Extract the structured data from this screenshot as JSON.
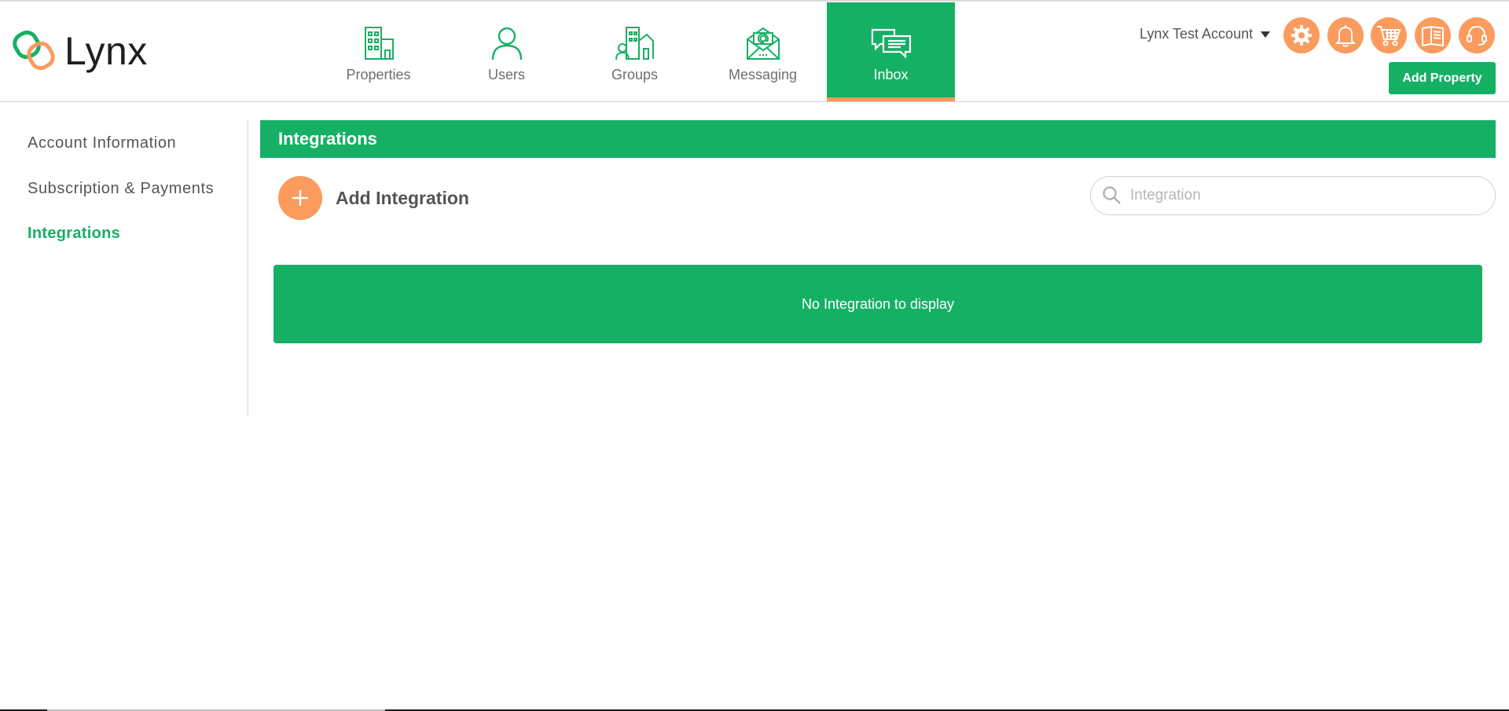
{
  "app": {
    "logo_text": "Lynx",
    "colors": {
      "primary": "#16b065",
      "accent": "#fb9b5d",
      "text": "#555555"
    }
  },
  "nav": {
    "items": [
      {
        "label": "Properties",
        "icon": "building-icon",
        "active": false
      },
      {
        "label": "Users",
        "icon": "user-icon",
        "active": false
      },
      {
        "label": "Groups",
        "icon": "groups-buildings-icon",
        "active": false
      },
      {
        "label": "Messaging",
        "icon": "mail-at-icon",
        "active": false
      },
      {
        "label": "Inbox",
        "icon": "chat-bubbles-icon",
        "active": true
      }
    ]
  },
  "header": {
    "account_name": "Lynx Test Account",
    "icons": [
      "gear-icon",
      "bell-icon",
      "cart-icon",
      "book-icon",
      "headset-icon"
    ],
    "add_property_label": "Add Property"
  },
  "sidebar": {
    "items": [
      {
        "label": "Account Information",
        "active": false
      },
      {
        "label": "Subscription & Payments",
        "active": false
      },
      {
        "label": "Integrations",
        "active": true
      }
    ]
  },
  "main": {
    "title": "Integrations",
    "add_label": "Add Integration",
    "search_placeholder": "Integration",
    "search_value": "",
    "empty_message": "No Integration to display"
  }
}
